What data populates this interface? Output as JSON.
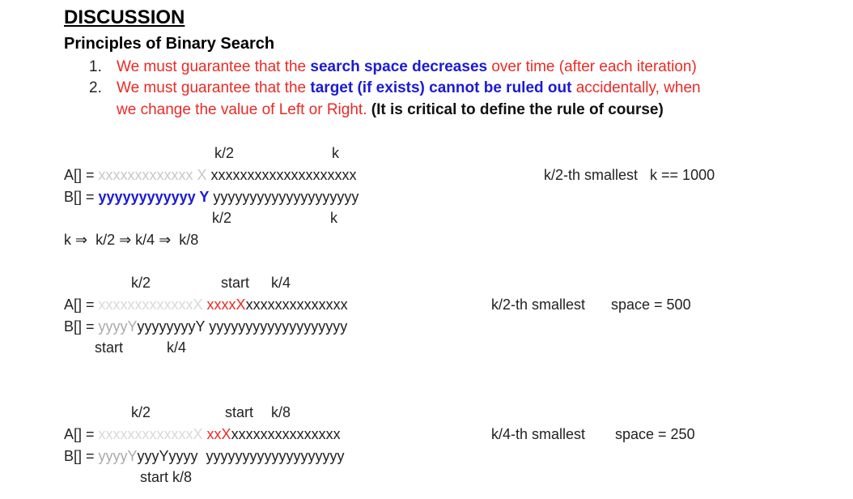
{
  "heading": "DISCUSSION",
  "subheading": "Principles of Binary Search",
  "principles": [
    {
      "num": "1.",
      "pre": "We must guarantee that the ",
      "hl": "search space decreases",
      "post": " over time (after each iteration)"
    },
    {
      "num": "2.",
      "pre": "We must guarantee that the ",
      "hl": "target (if exists) cannot be ruled out",
      "post": " accidentally, when",
      "line2": "we change the value of Left or Right. ",
      "note": "(It is critical to define the rule of course)"
    }
  ],
  "ex1": {
    "top_k2": "k/2",
    "top_k": "k",
    "a_prefix": "A[] = ",
    "a_gray": "xxxxxxxxxxxxx",
    "a_mark": " X",
    "a_rest": " xxxxxxxxxxxxxxxxxxxx",
    "b_prefix": "B[] = ",
    "b_blue": "yyyyyyyyyyyy Y",
    "b_rest": " yyyyyyyyyyyyyyyyyyyy",
    "bot_k2": "k/2",
    "bot_k": "k",
    "seq": "k ⇒  k/2 ⇒ k/4 ⇒  k/8",
    "note": "k/2-th smallest   k == 1000"
  },
  "ex2": {
    "top_k2": "k/2",
    "top_start": "start",
    "top_k4": "k/4",
    "a_prefix": "A[] = ",
    "a_faded": "xxxxxxxxxxxxxX ",
    "a_red": "xxxxX",
    "a_rest": "xxxxxxxxxxxxxx",
    "b_prefix": "B[] = ",
    "b_gray": "yyyyY",
    "b_rest": "yyyyyyyyY yyyyyyyyyyyyyyyyyyy",
    "bot_start": "start",
    "bot_k4": "k/4",
    "note_label": "k/2-th smallest",
    "note_space": "space = 500"
  },
  "ex3": {
    "top_k2": "k/2",
    "top_start": "start",
    "top_k8": "k/8",
    "a_prefix": "A[] = ",
    "a_faded": "xxxxxxxxxxxxxX ",
    "a_red": "xxX",
    "a_rest": "xxxxxxxxxxxxxxx",
    "b_prefix": "B[] = ",
    "b_gray": "yyyyY",
    "b_rest": "yyyYyyyy  yyyyyyyyyyyyyyyyyyy",
    "bot": "start k/8",
    "note_label": "k/4-th smallest",
    "note_space": "space = 250"
  }
}
